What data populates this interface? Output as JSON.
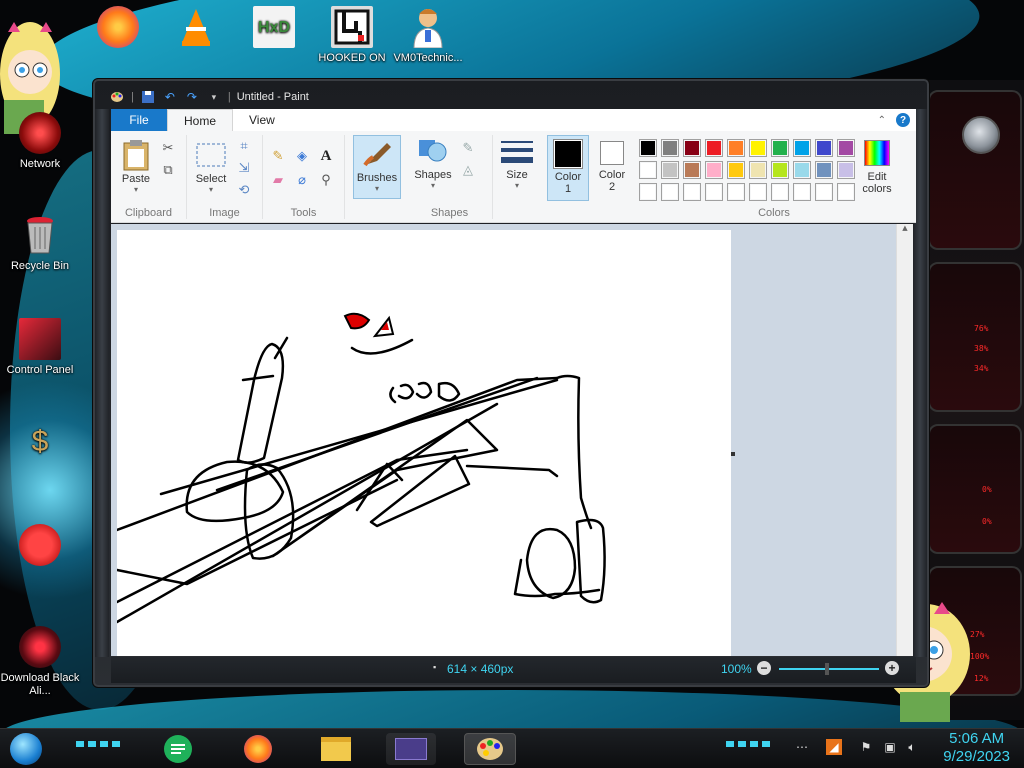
{
  "desktop": {
    "icons": [
      {
        "label": "",
        "icon": "firefox-icon"
      },
      {
        "label": "",
        "icon": "vlc-icon"
      },
      {
        "label": "",
        "icon": "hxd-icon"
      },
      {
        "label": "HOOKED ON",
        "icon": "maze-icon"
      },
      {
        "label": "VM0Technic...",
        "icon": "doctor-icon"
      },
      {
        "label": "Network",
        "icon": "network-icon"
      },
      {
        "label": "Recycle Bin",
        "icon": "recycle-bin-icon"
      },
      {
        "label": "Control Panel",
        "icon": "control-panel-icon"
      },
      {
        "label": "",
        "icon": "money-bag-icon"
      },
      {
        "label": "",
        "icon": "red-creature-icon"
      },
      {
        "label": "Download Black Ali...",
        "icon": "alienware-icon"
      }
    ],
    "side_readouts": [
      "76%",
      "38%",
      "34%",
      "0%",
      "0%",
      "27%",
      "100%",
      "12%"
    ]
  },
  "paint": {
    "window_title": "Untitled - Paint",
    "tabs": {
      "file": "File",
      "home": "Home",
      "view": "View"
    },
    "groups": {
      "clipboard": "Clipboard",
      "image": "Image",
      "tools": "Tools",
      "shapes": "Shapes",
      "colors": "Colors"
    },
    "buttons": {
      "paste": "Paste",
      "select": "Select",
      "brushes": "Brushes",
      "shapes": "Shapes",
      "size": "Size",
      "color1": "Color\n1",
      "color1_a": "Color",
      "color1_b": "1",
      "color2_a": "Color",
      "color2_b": "2",
      "edit_colors_a": "Edit",
      "edit_colors_b": "colors"
    },
    "palette_row1": [
      "#000000",
      "#7f7f7f",
      "#880015",
      "#ed1c24",
      "#ff7f27",
      "#fff200",
      "#22b14c",
      "#00a2e8",
      "#3f48cc",
      "#a349a4"
    ],
    "palette_row2": [
      "#ffffff",
      "#c3c3c3",
      "#b97a57",
      "#ffaec9",
      "#ffc90e",
      "#efe4b0",
      "#b5e61d",
      "#99d9ea",
      "#7092be",
      "#c8bfe7"
    ],
    "palette_row3": [
      "#ffffff",
      "#ffffff",
      "#ffffff",
      "#ffffff",
      "#ffffff",
      "#ffffff",
      "#ffffff",
      "#ffffff",
      "#ffffff",
      "#ffffff"
    ],
    "primary_color": "#000000",
    "secondary_color": "#ffffff",
    "status": {
      "dimensions": "614 × 460px",
      "zoom": "100%"
    }
  },
  "taskbar": {
    "time": "5:06 AM",
    "date": "9/29/2023"
  }
}
